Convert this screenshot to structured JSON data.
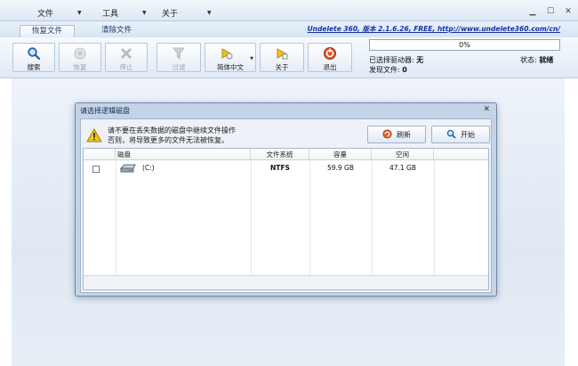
{
  "menu": [
    {
      "label": "文件"
    },
    {
      "label": "工具"
    },
    {
      "label": "关于"
    }
  ],
  "tabs": [
    {
      "label": "恢复文件",
      "active": true
    },
    {
      "label": "清除文件",
      "active": false
    }
  ],
  "brand_text": "Undelete 360, 版本 2.1.6.26, FREE, http://www.undelete360.com/cn/",
  "toolbar": {
    "search": "搜索",
    "recover": "恢复",
    "stop": "停止",
    "filter": "过滤",
    "language": "简体中文",
    "about": "关于",
    "exit": "退出"
  },
  "progress": {
    "value": 0,
    "text": "0%"
  },
  "status": {
    "selected_drive_label": "已选择驱动器:",
    "selected_drive_value": "无",
    "found_files_label": "发现文件:",
    "found_files_value": "0",
    "state_label": "状态:",
    "state_value": "就绪"
  },
  "dialog": {
    "title": "请选择逻辑磁盘",
    "close": "✕",
    "warning_line1": "请不要在丢失数据的磁盘中继续文件操作",
    "warning_line2": "否则，将导致更多的文件无法被恢复。",
    "refresh_button": "刷新",
    "start_button": "开始",
    "columns": [
      "磁盘",
      "文件系统",
      "容量",
      "空闲"
    ],
    "rows": [
      {
        "checked": false,
        "disk": "(C:)",
        "fs": "NTFS",
        "capacity": "59.9 GB",
        "free": "47.1 GB"
      }
    ]
  },
  "colors": {
    "accent_blue": "#1633a8",
    "progress_green": "#3ea24a",
    "warning_yellow": "#f3c21b",
    "exit_red": "#e2512b"
  },
  "icons": [
    "search-icon",
    "recover-icon",
    "stop-icon",
    "filter-icon",
    "language-icon",
    "about-icon",
    "exit-icon",
    "warning-icon",
    "refresh-icon",
    "start-icon",
    "drive-icon"
  ]
}
